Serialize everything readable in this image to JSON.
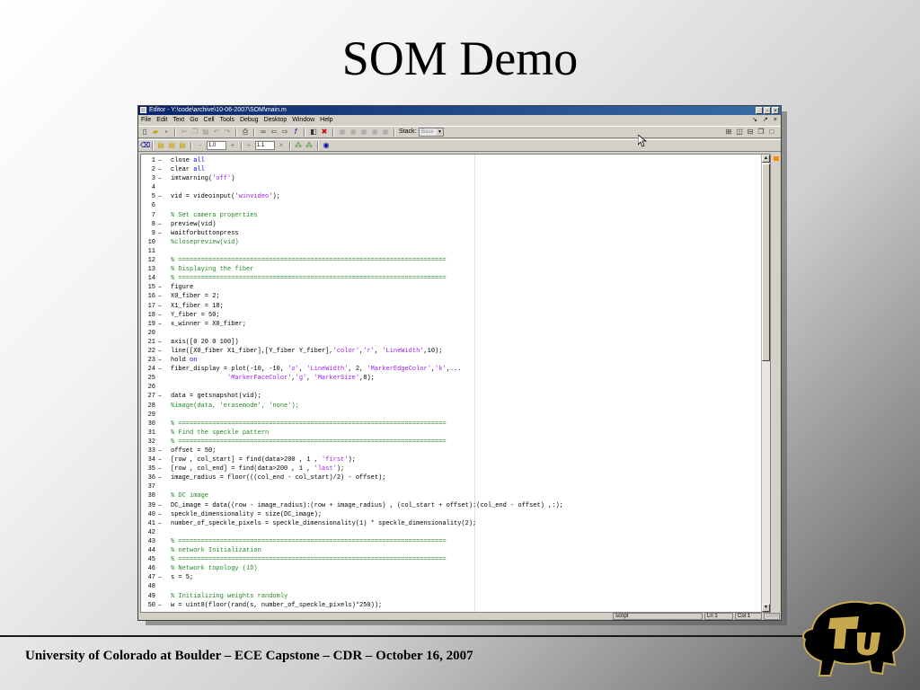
{
  "slide": {
    "title": "SOM Demo",
    "footer": "University of Colorado at Boulder – ECE Capstone – CDR – October 16, 2007"
  },
  "editor": {
    "window_title": "Editor - Y:\\code\\archive\\10-06-2007\\SOM\\main.m",
    "menu": [
      "File",
      "Edit",
      "Text",
      "Go",
      "Cell",
      "Tools",
      "Debug",
      "Desktop",
      "Window",
      "Help"
    ],
    "toolbar": {
      "stack_label": "Stack:",
      "stack_value": "Base",
      "cell_increment": "1.0",
      "cell_divide": "1.1",
      "minus": "-",
      "plus": "+",
      "divide": "÷",
      "times": "×"
    },
    "code_lines": [
      {
        "n": "1",
        "dash": true,
        "parts": [
          [
            "",
            "close "
          ],
          [
            "kw",
            "all"
          ]
        ]
      },
      {
        "n": "2",
        "dash": true,
        "parts": [
          [
            "",
            "clear "
          ],
          [
            "kw",
            "all"
          ]
        ]
      },
      {
        "n": "3",
        "dash": true,
        "parts": [
          [
            "",
            "imtwarning("
          ],
          [
            "str",
            "'off'"
          ],
          [
            "",
            ")"
          ]
        ]
      },
      {
        "n": "4",
        "dash": false,
        "parts": []
      },
      {
        "n": "5",
        "dash": true,
        "parts": [
          [
            "",
            "vid = videoinput("
          ],
          [
            "str",
            "'winvideo'"
          ],
          [
            "",
            ");"
          ]
        ]
      },
      {
        "n": "6",
        "dash": false,
        "parts": []
      },
      {
        "n": "7",
        "dash": false,
        "parts": [
          [
            "cmt",
            "% Set camera properties"
          ]
        ]
      },
      {
        "n": "8",
        "dash": true,
        "parts": [
          [
            "",
            "preview(vid)"
          ]
        ]
      },
      {
        "n": "9",
        "dash": true,
        "parts": [
          [
            "",
            "waitforbuttonpress"
          ]
        ]
      },
      {
        "n": "10",
        "dash": false,
        "parts": [
          [
            "cmt",
            "%closepreview(vid)"
          ]
        ]
      },
      {
        "n": "11",
        "dash": false,
        "parts": []
      },
      {
        "n": "12",
        "dash": false,
        "parts": [
          [
            "cmt",
            "% ======================================================================="
          ]
        ]
      },
      {
        "n": "13",
        "dash": false,
        "parts": [
          [
            "cmt",
            "% Displaying the fiber"
          ]
        ]
      },
      {
        "n": "14",
        "dash": false,
        "parts": [
          [
            "cmt",
            "% ======================================================================="
          ]
        ]
      },
      {
        "n": "15",
        "dash": true,
        "parts": [
          [
            "",
            "figure"
          ]
        ]
      },
      {
        "n": "16",
        "dash": true,
        "parts": [
          [
            "",
            "X0_fiber = 2;"
          ]
        ]
      },
      {
        "n": "17",
        "dash": true,
        "parts": [
          [
            "",
            "X1_fiber = 18;"
          ]
        ]
      },
      {
        "n": "18",
        "dash": true,
        "parts": [
          [
            "",
            "Y_fiber = 50;"
          ]
        ]
      },
      {
        "n": "19",
        "dash": true,
        "parts": [
          [
            "",
            "x_winner = X0_fiber;"
          ]
        ]
      },
      {
        "n": "20",
        "dash": false,
        "parts": []
      },
      {
        "n": "21",
        "dash": true,
        "parts": [
          [
            "",
            "axis([0 20 0 100])"
          ]
        ]
      },
      {
        "n": "22",
        "dash": true,
        "parts": [
          [
            "",
            "line([X0_fiber X1_fiber],[Y_fiber Y_fiber],"
          ],
          [
            "str",
            "'color'"
          ],
          [
            "",
            ","
          ],
          [
            "str",
            "'r'"
          ],
          [
            "",
            ", "
          ],
          [
            "str",
            "'LineWidth'"
          ],
          [
            "",
            ",10);"
          ]
        ]
      },
      {
        "n": "23",
        "dash": true,
        "parts": [
          [
            "",
            "hold "
          ],
          [
            "kw",
            "on"
          ]
        ]
      },
      {
        "n": "24",
        "dash": true,
        "parts": [
          [
            "",
            "fiber_display = plot(-10, -10, "
          ],
          [
            "str",
            "'o'"
          ],
          [
            "",
            ", "
          ],
          [
            "str",
            "'LineWidth'"
          ],
          [
            "",
            ", 2, "
          ],
          [
            "str",
            "'MarkerEdgeColor'"
          ],
          [
            "",
            ","
          ],
          [
            "str",
            "'k'"
          ],
          [
            "",
            ","
          ],
          [
            "kw",
            "..."
          ]
        ]
      },
      {
        "n": "25",
        "dash": false,
        "parts": [
          [
            "",
            "               "
          ],
          [
            "str",
            "'MarkerFaceColor'"
          ],
          [
            "",
            ","
          ],
          [
            "str",
            "'g'"
          ],
          [
            "",
            ", "
          ],
          [
            "str",
            "'MarkerSize'"
          ],
          [
            "",
            ",8);"
          ]
        ]
      },
      {
        "n": "26",
        "dash": false,
        "parts": []
      },
      {
        "n": "27",
        "dash": true,
        "parts": [
          [
            "",
            "data = getsnapshot(vid);"
          ]
        ]
      },
      {
        "n": "28",
        "dash": false,
        "parts": [
          [
            "cmt",
            "%image(data, 'erasemode', 'none');"
          ]
        ]
      },
      {
        "n": "29",
        "dash": false,
        "parts": []
      },
      {
        "n": "30",
        "dash": false,
        "parts": [
          [
            "cmt",
            "% ======================================================================="
          ]
        ]
      },
      {
        "n": "31",
        "dash": false,
        "parts": [
          [
            "cmt",
            "% Find the speckle pattern"
          ]
        ]
      },
      {
        "n": "32",
        "dash": false,
        "parts": [
          [
            "cmt",
            "% ======================================================================="
          ]
        ]
      },
      {
        "n": "33",
        "dash": true,
        "parts": [
          [
            "",
            "offset = 50;"
          ]
        ]
      },
      {
        "n": "34",
        "dash": true,
        "parts": [
          [
            "",
            "[row , col_start] = find(data>200 , 1 , "
          ],
          [
            "str",
            "'first'"
          ],
          [
            "",
            ");"
          ]
        ]
      },
      {
        "n": "35",
        "dash": true,
        "parts": [
          [
            "",
            "[row , col_end] = find(data>200 , 1 , "
          ],
          [
            "str",
            "'last'"
          ],
          [
            "",
            ");"
          ]
        ]
      },
      {
        "n": "36",
        "dash": true,
        "parts": [
          [
            "",
            "image_radius = floor(((col_end - col_start)/2) - offset);"
          ]
        ]
      },
      {
        "n": "37",
        "dash": false,
        "parts": []
      },
      {
        "n": "38",
        "dash": false,
        "parts": [
          [
            "cmt",
            "% DC image"
          ]
        ]
      },
      {
        "n": "39",
        "dash": true,
        "parts": [
          [
            "",
            "DC_image = data((row - image_radius):(row + image_radius) , (col_start + offset):(col_end - offset) ,:);"
          ]
        ]
      },
      {
        "n": "40",
        "dash": true,
        "parts": [
          [
            "",
            "speckle_dimensionality = size(DC_image);"
          ]
        ]
      },
      {
        "n": "41",
        "dash": true,
        "parts": [
          [
            "",
            "number_of_speckle_pixels = speckle_dimensionality(1) * speckle_dimensionality(2);"
          ]
        ]
      },
      {
        "n": "42",
        "dash": false,
        "parts": []
      },
      {
        "n": "43",
        "dash": false,
        "parts": [
          [
            "cmt",
            "% ======================================================================="
          ]
        ]
      },
      {
        "n": "44",
        "dash": false,
        "parts": [
          [
            "cmt",
            "% network Initialization"
          ]
        ]
      },
      {
        "n": "45",
        "dash": false,
        "parts": [
          [
            "cmt",
            "% ======================================================================="
          ]
        ]
      },
      {
        "n": "46",
        "dash": false,
        "parts": [
          [
            "cmt",
            "% Network topology (1D)"
          ]
        ]
      },
      {
        "n": "47",
        "dash": true,
        "parts": [
          [
            "",
            "s = 5;"
          ]
        ]
      },
      {
        "n": "48",
        "dash": false,
        "parts": []
      },
      {
        "n": "49",
        "dash": false,
        "parts": [
          [
            "cmt",
            "% Initializing weights randomly"
          ]
        ]
      },
      {
        "n": "50",
        "dash": true,
        "parts": [
          [
            "",
            "w = uint8(floor(rand(s, number_of_speckle_pixels)*250));"
          ]
        ]
      }
    ],
    "status": {
      "mode": "script",
      "ln_label": "Ln",
      "ln_value": "1",
      "col_label": "Col",
      "col_value": "1",
      "ovr": "OVR"
    }
  },
  "logo": {
    "text": "CU"
  },
  "colors": {
    "keyword": "#0000ff",
    "string": "#a020f0",
    "comment": "#228b22",
    "titlebar_start": "#0a246a",
    "titlebar_end": "#3a6ea5"
  }
}
